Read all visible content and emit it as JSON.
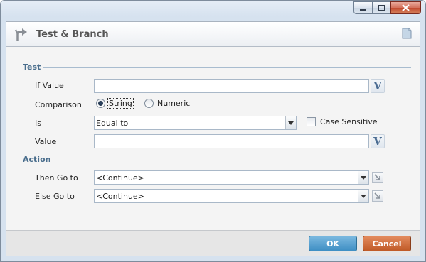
{
  "dialog": {
    "title": "Test & Branch"
  },
  "test_section": {
    "label": "Test",
    "if_value": {
      "label": "If Value",
      "value": ""
    },
    "comparison": {
      "label": "Comparison",
      "options": [
        "String",
        "Numeric"
      ],
      "selected": "String"
    },
    "is": {
      "label": "Is",
      "selected": "Equal to",
      "case_sensitive_label": "Case Sensitive",
      "case_sensitive_checked": false
    },
    "value": {
      "label": "Value",
      "value": ""
    },
    "variable_button_glyph": "V"
  },
  "action_section": {
    "label": "Action",
    "then_go_to": {
      "label": "Then Go to",
      "selected": "<Continue>"
    },
    "else_go_to": {
      "label": "Else Go to",
      "selected": "<Continue>"
    }
  },
  "footer": {
    "ok_label": "OK",
    "cancel_label": "Cancel"
  },
  "colors": {
    "ok_button": "#3e8fc4",
    "cancel_button": "#c05a27",
    "section_label": "#4a6e8d"
  },
  "icons": {
    "header": "branch-arrow-icon",
    "help": "note-icon",
    "goto": "goto-arrow-icon"
  }
}
